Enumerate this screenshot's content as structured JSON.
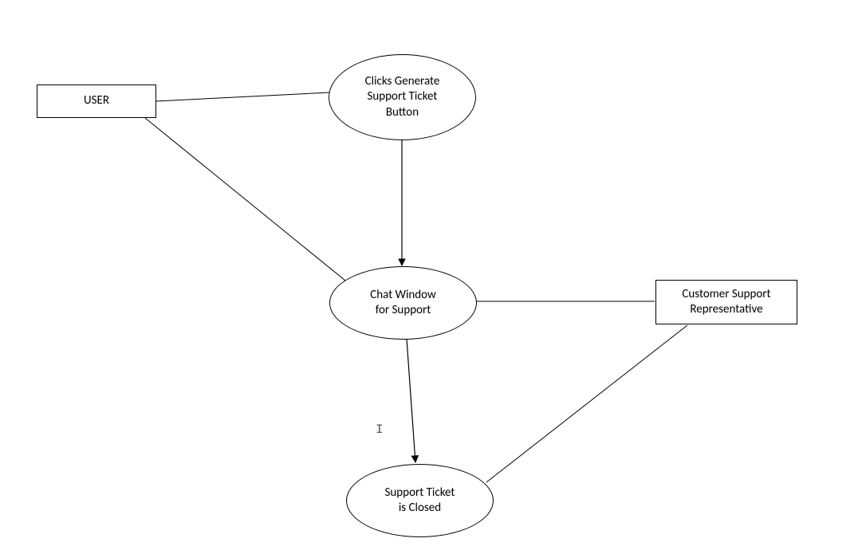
{
  "nodes": {
    "user": {
      "label": "USER"
    },
    "clicks_generate": {
      "label": "Clicks Generate\nSupport Ticket\nButton"
    },
    "chat_window": {
      "label": "Chat Window\nfor Support"
    },
    "csr": {
      "label": "Customer Support\nRepresentative"
    },
    "ticket_closed": {
      "label": "Support Ticket\nis Closed"
    }
  },
  "cursor": {
    "glyph": "I"
  }
}
